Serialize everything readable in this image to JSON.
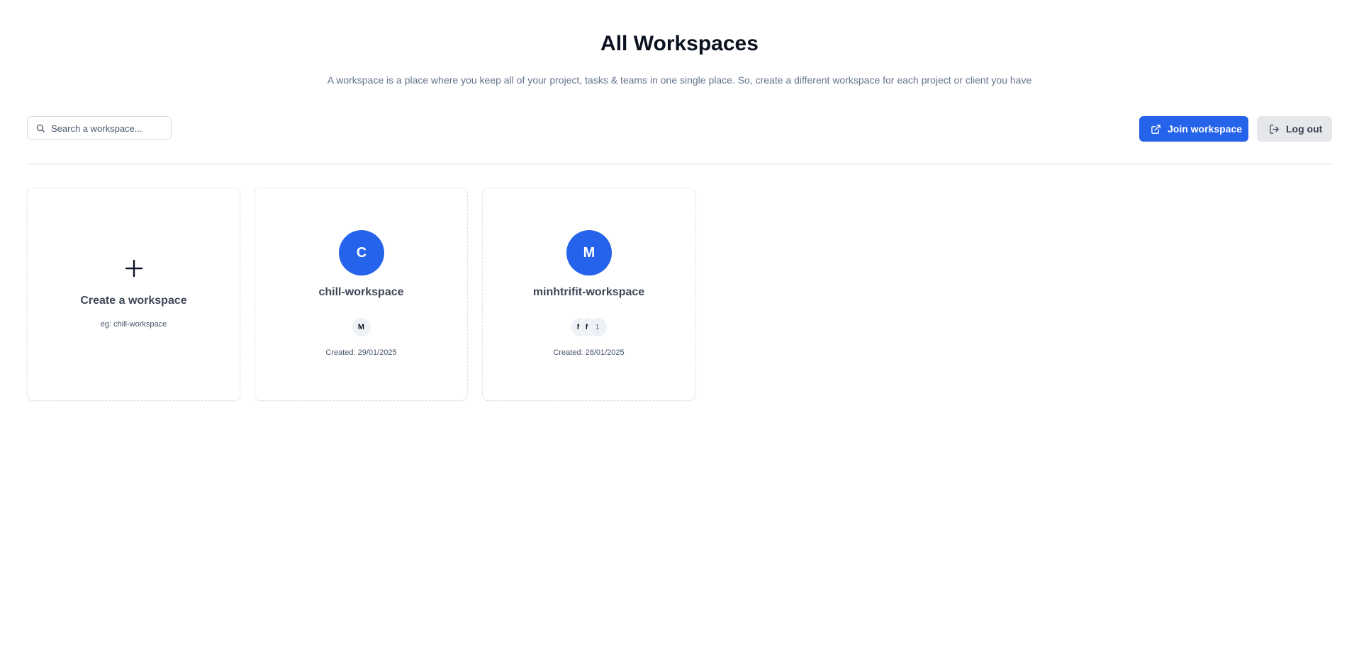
{
  "header": {
    "title": "All Workspaces",
    "subtitle": "A workspace is a place where you keep all of your project, tasks & teams in one single place. So, create a different workspace for each project or client you have"
  },
  "search": {
    "placeholder": "Search a workspace...",
    "icon": "search-icon"
  },
  "actions": {
    "join_label": "Join workspace",
    "join_icon": "external-link-icon",
    "logout_label": "Log out",
    "logout_icon": "logout-icon"
  },
  "create_card": {
    "icon": "plus-icon",
    "title": "Create a workspace",
    "hint": "eg: chill-workspace"
  },
  "workspaces": [
    {
      "initial": "C",
      "name": "chill-workspace",
      "members": [
        "M"
      ],
      "created": "Created: 29/01/2025"
    },
    {
      "initial": "M",
      "name": "minhtrifit-workspace",
      "members": [
        "M",
        "M",
        "1"
      ],
      "created": "Created: 28/01/2025"
    }
  ],
  "colors": {
    "accent": "#2563eb",
    "secondary_button": "#e5e7eb",
    "muted_text": "#64748b"
  }
}
